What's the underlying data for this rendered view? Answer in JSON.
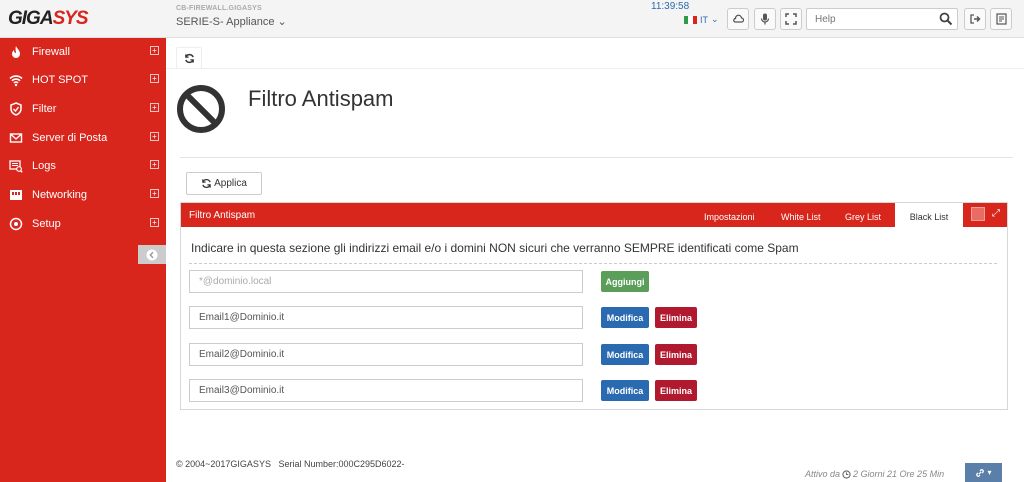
{
  "header": {
    "logo_prefix": "GIGA",
    "logo_suffix": "SYS",
    "hostname": "CB-FIREWALL.GIGASYS",
    "model": "SERIE-S- Appliance",
    "time": "11:39:58",
    "language": "IT",
    "help_placeholder": "Help"
  },
  "sidebar": {
    "items": [
      {
        "label": "Firewall",
        "icon": "flame-icon"
      },
      {
        "label": "HOT SPOT",
        "icon": "wifi-icon"
      },
      {
        "label": "Filter",
        "icon": "shield-icon"
      },
      {
        "label": "Server di Posta",
        "icon": "envelope-icon"
      },
      {
        "label": "Logs",
        "icon": "logs-icon"
      },
      {
        "label": "Networking",
        "icon": "network-icon"
      },
      {
        "label": "Setup",
        "icon": "setup-icon"
      }
    ]
  },
  "page": {
    "title": "Filtro Antispam",
    "apply_label": "Applica"
  },
  "panel": {
    "title": "Filtro Antispam",
    "tabs": [
      "Impostazioni",
      "White List",
      "Grey List",
      "Black List"
    ],
    "active_tab": "Black List",
    "description": "Indicare in questa sezione gli indirizzi email e/o i domini NON sicuri che verranno SEMPRE identificati come Spam",
    "new_entry_placeholder": "*@dominio.local",
    "add_label": "Aggiungi",
    "edit_label": "Modifica",
    "delete_label": "Elimina",
    "entries": [
      "Email1@Dominio.it",
      "Email2@Dominio.it",
      "Email3@Dominio.it"
    ]
  },
  "footer": {
    "copyright": "© 2004~2017GIGASYS",
    "serial": "Serial Number:000C295D6022-",
    "uptime_prefix": "Attivo da",
    "uptime_value": "2 Giorni 21 Ore 25 Min"
  },
  "colors": {
    "brand_red": "#d9261c",
    "blue": "#2a6ab0",
    "green": "#5a9e5a",
    "dark_red": "#b0192e"
  }
}
